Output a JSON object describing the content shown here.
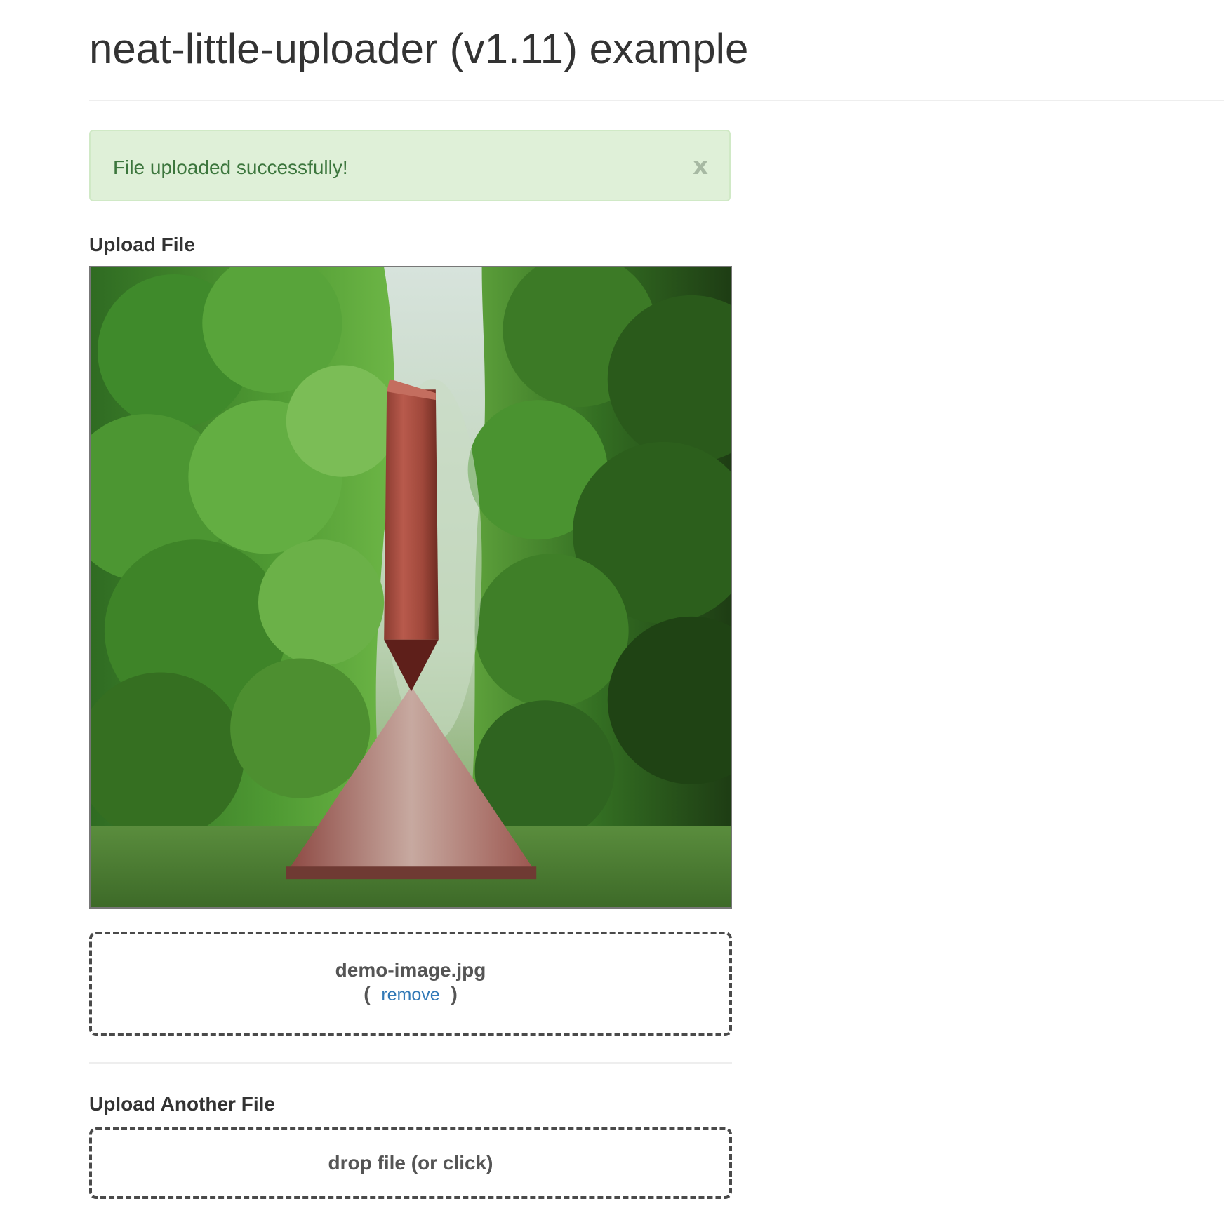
{
  "page": {
    "title": "neat-little-uploader (v1.11) example"
  },
  "alert": {
    "message": "File uploaded successfully!",
    "close_label": "x"
  },
  "upload_section": {
    "label": "Upload File",
    "preview_alt": "demo-image.jpg",
    "file_name": "demo-image.jpg",
    "remove_open": "(",
    "remove_label": "remove",
    "remove_close": ")"
  },
  "another_section": {
    "label": "Upload Another File",
    "prompt": "drop file (or click)"
  },
  "colors": {
    "alert_bg": "#dff0d8",
    "alert_text": "#3c763d",
    "link": "#337ab7",
    "text": "#333333"
  }
}
